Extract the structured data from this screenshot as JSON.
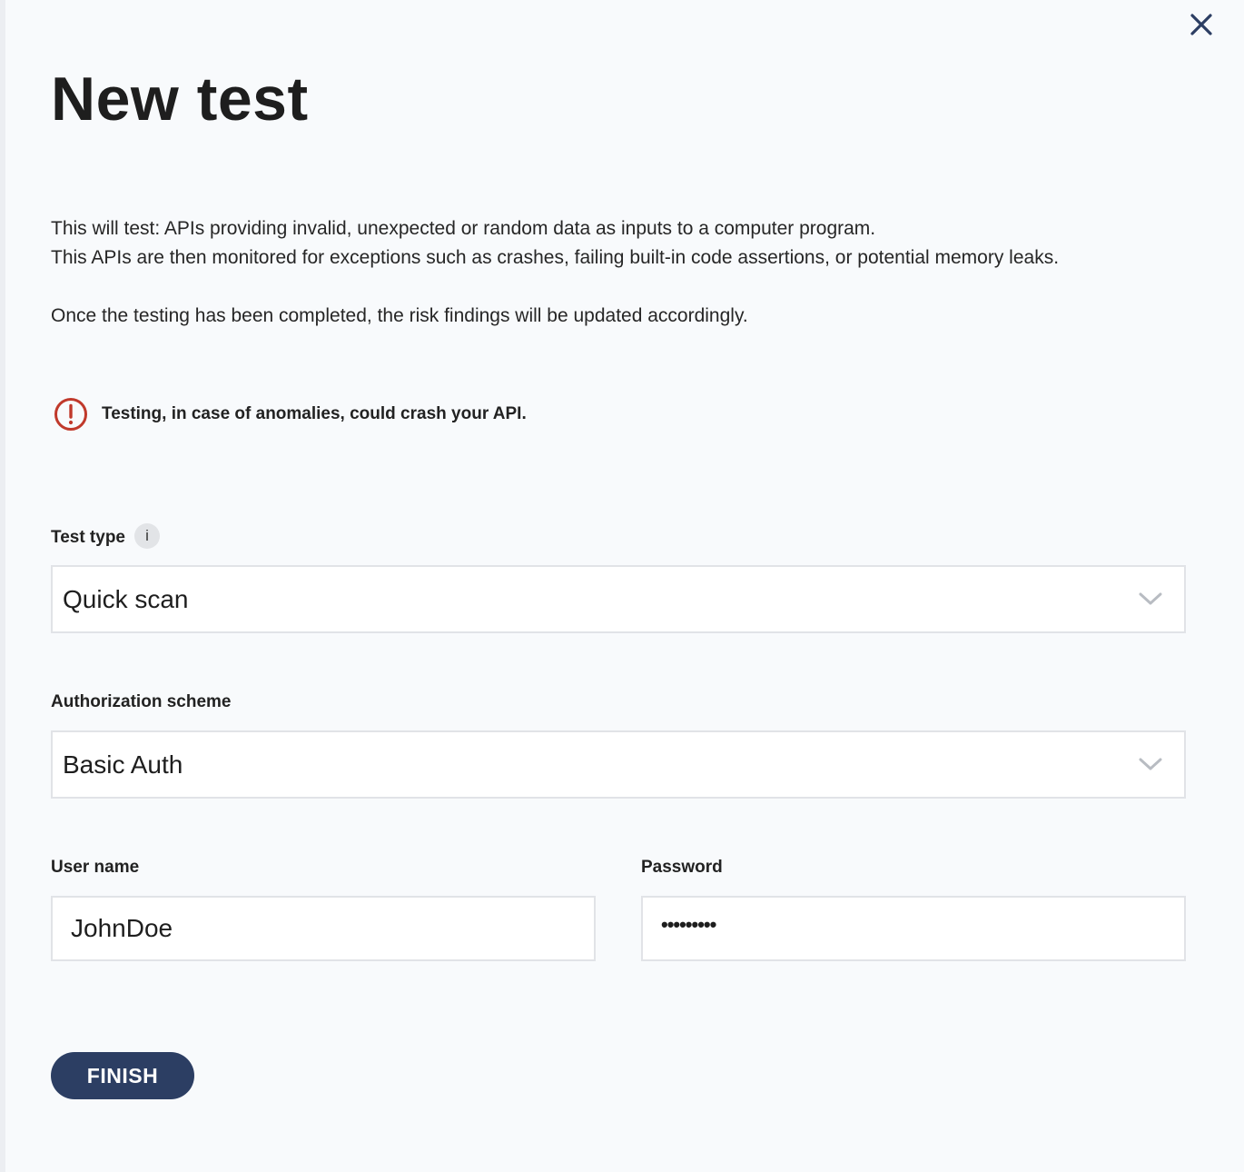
{
  "dialog": {
    "title": "New test",
    "description": {
      "line1": "This will test: APIs providing invalid, unexpected or random data as inputs to a computer program.",
      "line2": "This APIs are then monitored for exceptions such as crashes, failing built-in code assertions, or potential memory leaks.",
      "line3": "Once the testing has been completed, the risk findings will be updated accordingly."
    },
    "warning": {
      "text": "Testing, in case of anomalies, could crash your API.",
      "icon": "alert-circle-icon",
      "color": "#c0392b"
    }
  },
  "form": {
    "test_type": {
      "label": "Test type",
      "info_icon": "i",
      "value": "Quick scan"
    },
    "auth_scheme": {
      "label": "Authorization scheme",
      "value": "Basic Auth"
    },
    "username": {
      "label": "User name",
      "value": "JohnDoe"
    },
    "password": {
      "label": "Password",
      "value": "•••••••••"
    }
  },
  "actions": {
    "finish_label": "FINISH"
  },
  "colors": {
    "primary": "#2c3e63",
    "close_icon": "#2c3e63",
    "warning": "#c0392b",
    "background": "#f8fafc"
  }
}
